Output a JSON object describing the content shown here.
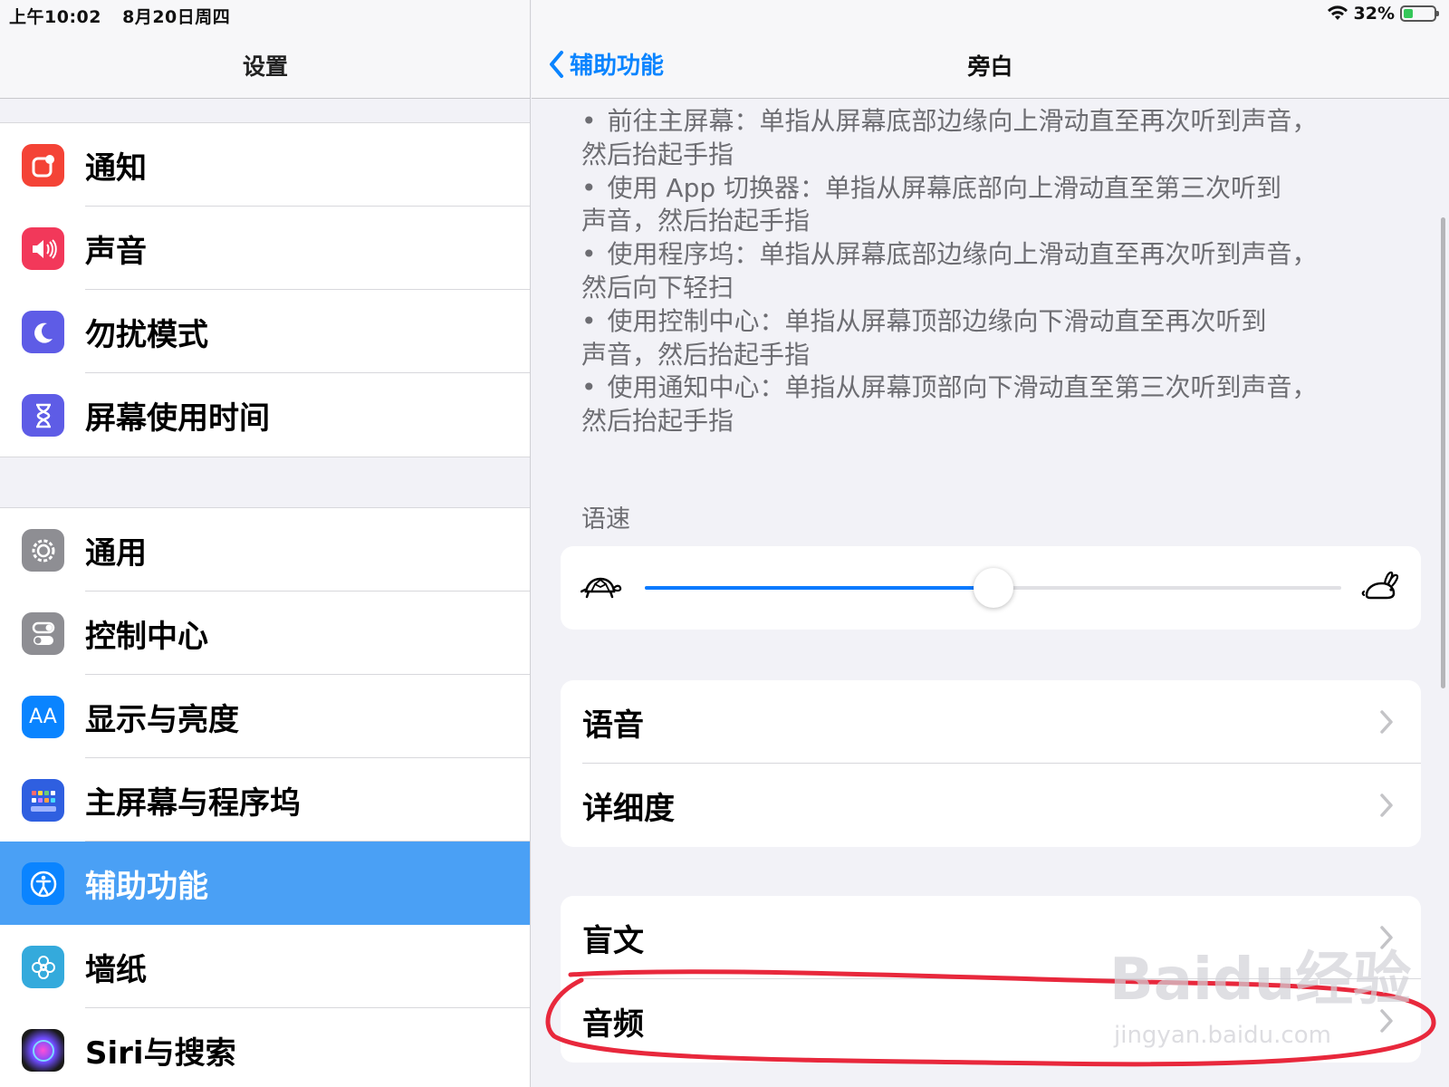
{
  "status": {
    "time": "上午10:02",
    "date": "8月20日周四",
    "battery": "32%",
    "battery_level": 0.32
  },
  "left": {
    "title": "设置",
    "group1": [
      {
        "label": "通知",
        "icon": "notifications-icon",
        "color": "#f44336"
      },
      {
        "label": "声音",
        "icon": "speaker-icon",
        "color": "#f2385a"
      },
      {
        "label": "勿扰模式",
        "icon": "moon-icon",
        "color": "#5e5ce6"
      },
      {
        "label": "屏幕使用时间",
        "icon": "hourglass-icon",
        "color": "#5e5ce6"
      }
    ],
    "group2": [
      {
        "label": "通用",
        "icon": "gear-icon",
        "color": "#8e8e93"
      },
      {
        "label": "控制中心",
        "icon": "toggles-icon",
        "color": "#8e8e93"
      },
      {
        "label": "显示与亮度",
        "icon": "display-aa-icon",
        "color": "#0a84ff",
        "glyph": "AA"
      },
      {
        "label": "主屏幕与程序坞",
        "icon": "home-grid-icon",
        "color": "#2f5fe0"
      },
      {
        "label": "辅助功能",
        "icon": "accessibility-icon",
        "color": "#0a84ff",
        "selected": true
      },
      {
        "label": "墙纸",
        "icon": "flower-icon",
        "color": "#34aadc"
      },
      {
        "label": "Siri与搜索",
        "icon": "siri-icon",
        "color": "#222"
      }
    ]
  },
  "right": {
    "back_label": "辅助功能",
    "title": "旁白",
    "hint_lines": [
      {
        "text": "前往主屏幕：单指从屏幕底部边缘向上滑动直至再次听到声音，",
        "bullet": true
      },
      {
        "text": "然后抬起手指",
        "bullet": false
      },
      {
        "text": "使用 App 切换器：单指从屏幕底部向上滑动直至第三次听到",
        "bullet": true
      },
      {
        "text": "声音，然后抬起手指",
        "bullet": false
      },
      {
        "text": "使用程序坞：单指从屏幕底部边缘向上滑动直至再次听到声音，",
        "bullet": true
      },
      {
        "text": "然后向下轻扫",
        "bullet": false
      },
      {
        "text": "使用控制中心：单指从屏幕顶部边缘向下滑动直至再次听到",
        "bullet": true
      },
      {
        "text": "声音，然后抬起手指",
        "bullet": false
      },
      {
        "text": "使用通知中心：单指从屏幕顶部向下滑动直至第三次听到声音，",
        "bullet": true
      },
      {
        "text": "然后抬起手指",
        "bullet": false
      }
    ],
    "speed_label": "语速",
    "speed_value": 0.5,
    "group_a": [
      "语音",
      "详细度"
    ],
    "group_b": [
      "盲文",
      "音频"
    ]
  },
  "watermark": {
    "main": "Baidu经验",
    "sub": "jingyan.baidu.com"
  }
}
